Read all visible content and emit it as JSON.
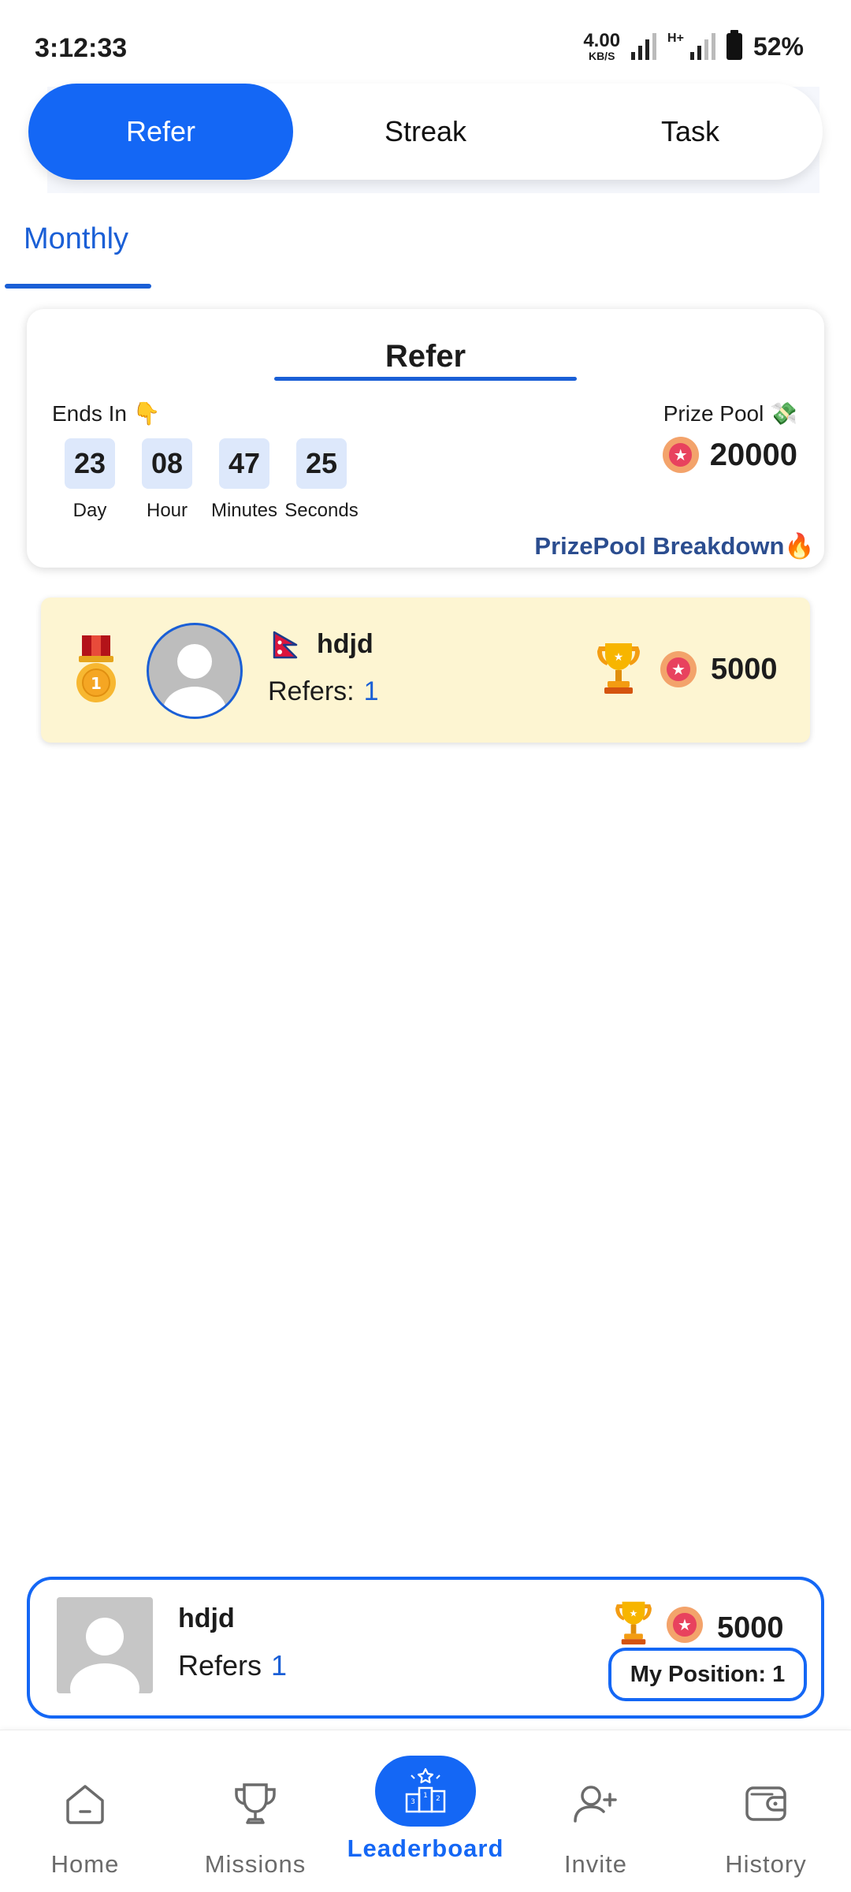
{
  "status_bar": {
    "time": "3:12:33",
    "net_speed_value": "4.00",
    "net_speed_unit": "KB/S",
    "network_type": "H+",
    "battery": "52%"
  },
  "tabs": [
    {
      "label": "Refer",
      "active": true
    },
    {
      "label": "Streak",
      "active": false
    },
    {
      "label": "Task",
      "active": false
    }
  ],
  "period_tab": "Monthly",
  "refer_card": {
    "title": "Refer",
    "ends_in_label": "Ends In 👇",
    "prize_pool_label": "Prize Pool 💸",
    "prize_pool_amount": "20000",
    "countdown": [
      {
        "value": "23",
        "label": "Day"
      },
      {
        "value": "08",
        "label": "Hour"
      },
      {
        "value": "47",
        "label": "Minutes"
      },
      {
        "value": "25",
        "label": "Seconds"
      }
    ],
    "breakdown_link": "PrizePool Breakdown",
    "breakdown_emoji": "🔥"
  },
  "leaderboard": [
    {
      "rank": "1",
      "flag": "nepal-flag",
      "name": "hdjd",
      "refers_label": "Refers:",
      "refers_count": "1",
      "points": "5000"
    }
  ],
  "my_position": {
    "name": "hdjd",
    "refers_label": "Refers",
    "refers_count": "1",
    "points": "5000",
    "position_label": "My Position: 1"
  },
  "bottom_nav": [
    {
      "label": "Home",
      "icon": "home-icon",
      "active": false
    },
    {
      "label": "Missions",
      "icon": "trophy-icon",
      "active": false
    },
    {
      "label": "Leaderboard",
      "icon": "podium-icon",
      "active": true
    },
    {
      "label": "Invite",
      "icon": "add-user-icon",
      "active": false
    },
    {
      "label": "History",
      "icon": "wallet-icon",
      "active": false
    }
  ],
  "colors": {
    "primary": "#1467f5",
    "accent_text": "#1a5fd6",
    "row_highlight": "#fdf5d2",
    "countdown_box": "#dde8fb"
  }
}
